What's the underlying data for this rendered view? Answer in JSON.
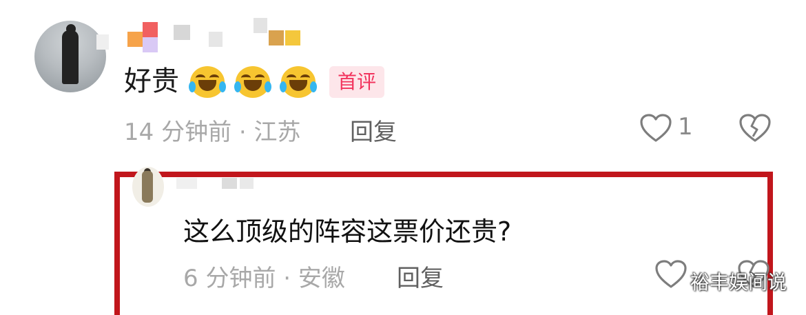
{
  "comment": {
    "text": "好贵",
    "badge": "首评",
    "time_location": "14 分钟前 · 江苏",
    "reply_label": "回复",
    "like_count": "1"
  },
  "reply_comment": {
    "text": "这么顶级的阵容这票价还贵?",
    "time_location": "6 分钟前 · 安徽",
    "reply_label": "回复"
  },
  "watermark": "裕丰娱间说",
  "colors": {
    "badge_text": "#f2335d",
    "badge_bg": "#fde6ea",
    "highlight_box": "#c1161c"
  },
  "icons": [
    "heart-icon",
    "broken-heart-icon",
    "laugh-cry-emoji"
  ]
}
